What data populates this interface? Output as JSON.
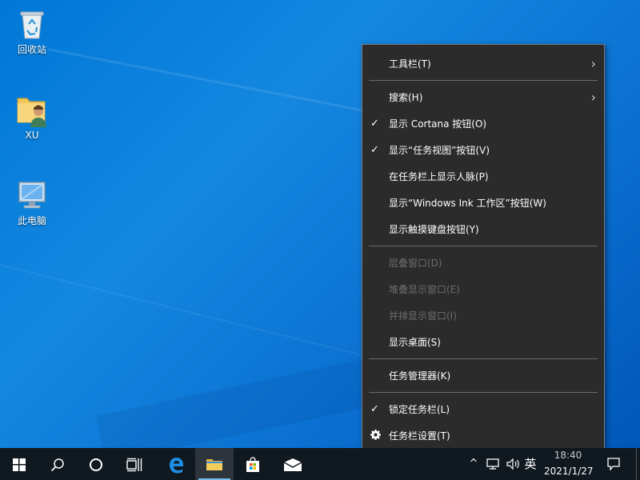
{
  "desktop": {
    "icons": [
      {
        "label": "回收站",
        "icon": "recycle-bin-icon"
      },
      {
        "label": "XU",
        "icon": "user-folder-icon"
      },
      {
        "label": "此电脑",
        "icon": "this-pc-icon"
      }
    ]
  },
  "context_menu": {
    "items": [
      {
        "label": "工具栏(T)",
        "checked": false,
        "submenu": true,
        "disabled": false
      },
      {
        "label": "搜索(H)",
        "checked": false,
        "submenu": true,
        "disabled": false
      },
      {
        "label": "显示 Cortana 按钮(O)",
        "checked": true,
        "submenu": false,
        "disabled": false
      },
      {
        "label": "显示“任务视图”按钮(V)",
        "checked": true,
        "submenu": false,
        "disabled": false
      },
      {
        "label": "在任务栏上显示人脉(P)",
        "checked": false,
        "submenu": false,
        "disabled": false
      },
      {
        "label": "显示“Windows Ink 工作区”按钮(W)",
        "checked": false,
        "submenu": false,
        "disabled": false
      },
      {
        "label": "显示触摸键盘按钮(Y)",
        "checked": false,
        "submenu": false,
        "disabled": false
      },
      {
        "label": "层叠窗口(D)",
        "checked": false,
        "submenu": false,
        "disabled": true
      },
      {
        "label": "堆叠显示窗口(E)",
        "checked": false,
        "submenu": false,
        "disabled": true
      },
      {
        "label": "并排显示窗口(I)",
        "checked": false,
        "submenu": false,
        "disabled": true
      },
      {
        "label": "显示桌面(S)",
        "checked": false,
        "submenu": false,
        "disabled": false
      },
      {
        "label": "任务管理器(K)",
        "checked": false,
        "submenu": false,
        "disabled": false
      },
      {
        "label": "锁定任务栏(L)",
        "checked": true,
        "submenu": false,
        "disabled": false
      },
      {
        "label": "任务栏设置(T)",
        "checked": false,
        "submenu": false,
        "disabled": false,
        "icon": "gear-icon"
      }
    ],
    "check_glyph": "✓",
    "arrow_glyph": "›"
  },
  "taskbar": {
    "buttons": [
      {
        "name": "start-button",
        "icon": "windows-logo-icon"
      },
      {
        "name": "search-button",
        "icon": "search-icon"
      },
      {
        "name": "cortana-button",
        "icon": "cortana-ring-icon"
      },
      {
        "name": "task-view-button",
        "icon": "task-view-icon"
      },
      {
        "name": "edge-button",
        "icon": "edge-icon"
      },
      {
        "name": "file-explorer-button",
        "icon": "folder-icon",
        "active": true
      },
      {
        "name": "store-button",
        "icon": "store-bag-icon"
      },
      {
        "name": "mail-button",
        "icon": "mail-icon"
      }
    ],
    "tray": {
      "chevron": "^",
      "ime": "英",
      "time": "18:40",
      "date": "2021/1/27"
    }
  },
  "colors": {
    "desktop_blue": "#0078d7",
    "menu_bg": "#2b2b2b",
    "taskbar_bg": "#101820",
    "disabled_text": "#6d6d6d",
    "active_indicator": "#76b9ed"
  }
}
